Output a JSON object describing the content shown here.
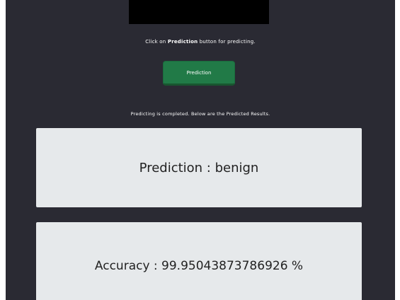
{
  "instruction": {
    "prefix": "Click on ",
    "button_name": "Prediction",
    "suffix": " button for predicting."
  },
  "prediction_button": {
    "label": "Prediction"
  },
  "status_message": "Predicting is completed. Below are the Predicted Results.",
  "results": {
    "prediction": "Prediction : benign",
    "accuracy": "Accuracy : 99.95043873786926 %"
  },
  "colors": {
    "background": "#2a2a33",
    "button": "#217a47",
    "card": "#e6e9eb"
  }
}
